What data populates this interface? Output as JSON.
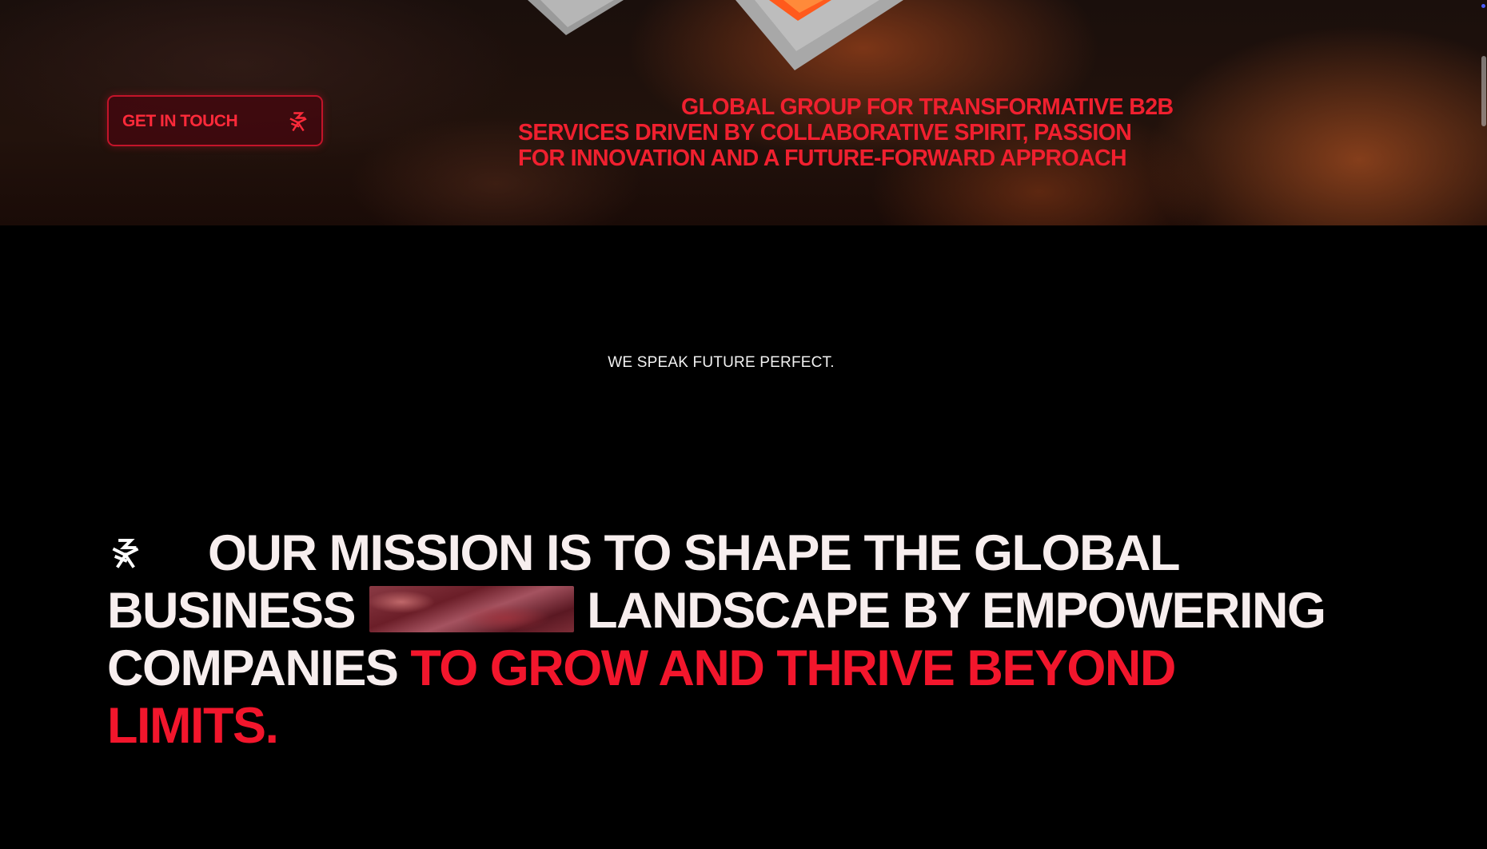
{
  "hero": {
    "cta": {
      "label": "GET IN TOUCH",
      "icon": "asterisk-logo-icon"
    },
    "tagline": "GLOBAL GROUP FOR TRANSFORMATIVE B2B SERVICES DRIVEN BY COLLABORATIVE SPIRIT, PASSION FOR INNOVATION AND A FUTURE-FORWARD APPROACH",
    "background_image": "dark orange abstract texture with 3D diamond shapes"
  },
  "slogan": "WE SPEAK FUTURE PERFECT.",
  "mission": {
    "icon": "asterisk-logo-icon",
    "text_before_image": "OUR MISSION IS TO SHAPE THE GLOBAL BUSINESS",
    "inline_image": "red-abstract-landscape-image",
    "text_after_image": "LANDSCAPE BY EMPOWERING COMPANIES",
    "highlight": "TO GROW AND THRIVE BEYOND LIMITS."
  },
  "colors": {
    "accent_red": "#f2162c",
    "background": "#000000",
    "text_light": "#f7eeee"
  }
}
